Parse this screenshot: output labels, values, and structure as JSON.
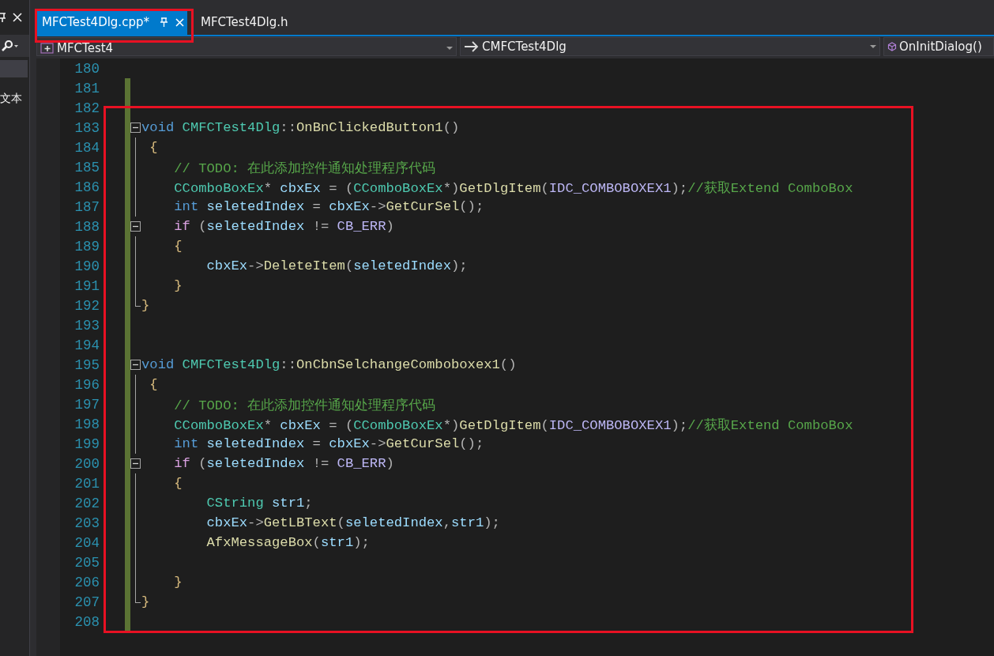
{
  "side_panel": {
    "label": "文本"
  },
  "tabs": [
    {
      "label": "MFCTest4Dlg.cpp*",
      "selected": true
    },
    {
      "label": "MFCTest4Dlg.h",
      "selected": false
    }
  ],
  "nav_bar": {
    "project": "MFCTest4",
    "class": "CMFCTest4Dlg",
    "member": "OnInitDialog()"
  },
  "lines": [
    {
      "number": "180",
      "changed": false,
      "kind": "plain"
    },
    {
      "number": "181",
      "changed": true,
      "kind": "plain"
    },
    {
      "number": "182",
      "changed": true,
      "kind": "plain"
    },
    {
      "number": "183",
      "changed": true,
      "kind": "foldstart",
      "tokens": [
        {
          "kind": "kw",
          "text": "void "
        },
        {
          "kind": "type",
          "text": "CMFCTest4Dlg"
        },
        {
          "kind": "punc",
          "text": "::"
        },
        {
          "kind": "fn",
          "text": "OnBnClickedButton1"
        },
        {
          "kind": "punc",
          "text": "()"
        }
      ]
    },
    {
      "number": "184",
      "changed": true,
      "kind": "foldbody",
      "tokens": [
        {
          "kind": "brace",
          "text": " {"
        }
      ]
    },
    {
      "number": "185",
      "changed": true,
      "kind": "foldbody",
      "tokens": [
        {
          "kind": "comment",
          "text": "    // TODO: 在此添加控件通知处理程序代码"
        }
      ]
    },
    {
      "number": "186",
      "changed": true,
      "kind": "foldbody",
      "tokens": [
        {
          "kind": "type",
          "text": "    CComboBoxEx"
        },
        {
          "kind": "plain",
          "text": "* "
        },
        {
          "kind": "var",
          "text": "cbxEx"
        },
        {
          "kind": "plain",
          "text": " = ("
        },
        {
          "kind": "type",
          "text": "CComboBoxEx"
        },
        {
          "kind": "plain",
          "text": "*)"
        },
        {
          "kind": "fn",
          "text": "GetDlgItem"
        },
        {
          "kind": "punc",
          "text": "("
        },
        {
          "kind": "macro",
          "text": "IDC_COMBOBOXEX1"
        },
        {
          "kind": "punc",
          "text": ");"
        },
        {
          "kind": "comment",
          "text": "//获取Extend ComboBox"
        }
      ]
    },
    {
      "number": "187",
      "changed": true,
      "kind": "foldbody",
      "tokens": [
        {
          "kind": "kw",
          "text": "    int "
        },
        {
          "kind": "var",
          "text": "seletedIndex"
        },
        {
          "kind": "plain",
          "text": " = "
        },
        {
          "kind": "var",
          "text": "cbxEx"
        },
        {
          "kind": "plain",
          "text": "->"
        },
        {
          "kind": "fn",
          "text": "GetCurSel"
        },
        {
          "kind": "punc",
          "text": "();"
        }
      ]
    },
    {
      "number": "188",
      "changed": true,
      "kind": "foldstart",
      "tokens": [
        {
          "kind": "ctrl",
          "text": "    if "
        },
        {
          "kind": "punc",
          "text": "("
        },
        {
          "kind": "var",
          "text": "seletedIndex"
        },
        {
          "kind": "plain",
          "text": " != "
        },
        {
          "kind": "macro",
          "text": "CB_ERR"
        },
        {
          "kind": "punc",
          "text": ")"
        }
      ]
    },
    {
      "number": "189",
      "changed": true,
      "kind": "foldbody",
      "tokens": [
        {
          "kind": "brace",
          "text": "    {"
        }
      ]
    },
    {
      "number": "190",
      "changed": true,
      "kind": "foldbody",
      "tokens": [
        {
          "kind": "var",
          "text": "        cbxEx"
        },
        {
          "kind": "plain",
          "text": "->"
        },
        {
          "kind": "fn",
          "text": "DeleteItem"
        },
        {
          "kind": "punc",
          "text": "("
        },
        {
          "kind": "var",
          "text": "seletedIndex"
        },
        {
          "kind": "punc",
          "text": ");"
        }
      ]
    },
    {
      "number": "191",
      "changed": true,
      "kind": "foldbody",
      "tokens": [
        {
          "kind": "brace",
          "text": "    }"
        }
      ]
    },
    {
      "number": "192",
      "changed": true,
      "kind": "foldend",
      "tokens": [
        {
          "kind": "brace",
          "text": "}"
        }
      ]
    },
    {
      "number": "193",
      "changed": true,
      "kind": "plain"
    },
    {
      "number": "194",
      "changed": true,
      "kind": "plain"
    },
    {
      "number": "195",
      "changed": true,
      "kind": "foldstart",
      "tokens": [
        {
          "kind": "kw",
          "text": "void "
        },
        {
          "kind": "type",
          "text": "CMFCTest4Dlg"
        },
        {
          "kind": "punc",
          "text": "::"
        },
        {
          "kind": "fn",
          "text": "OnCbnSelchangeComboboxex1"
        },
        {
          "kind": "punc",
          "text": "()"
        }
      ]
    },
    {
      "number": "196",
      "changed": true,
      "kind": "foldbody",
      "tokens": [
        {
          "kind": "brace",
          "text": " {"
        }
      ]
    },
    {
      "number": "197",
      "changed": true,
      "kind": "foldbody",
      "tokens": [
        {
          "kind": "comment",
          "text": "    // TODO: 在此添加控件通知处理程序代码"
        }
      ]
    },
    {
      "number": "198",
      "changed": true,
      "kind": "foldbody",
      "tokens": [
        {
          "kind": "type",
          "text": "    CComboBoxEx"
        },
        {
          "kind": "plain",
          "text": "* "
        },
        {
          "kind": "var",
          "text": "cbxEx"
        },
        {
          "kind": "plain",
          "text": " = ("
        },
        {
          "kind": "type",
          "text": "CComboBoxEx"
        },
        {
          "kind": "plain",
          "text": "*)"
        },
        {
          "kind": "fn",
          "text": "GetDlgItem"
        },
        {
          "kind": "punc",
          "text": "("
        },
        {
          "kind": "macro",
          "text": "IDC_COMBOBOXEX1"
        },
        {
          "kind": "punc",
          "text": ");"
        },
        {
          "kind": "comment",
          "text": "//获取Extend ComboBox"
        }
      ]
    },
    {
      "number": "199",
      "changed": true,
      "kind": "foldbody",
      "tokens": [
        {
          "kind": "kw",
          "text": "    int "
        },
        {
          "kind": "var",
          "text": "seletedIndex"
        },
        {
          "kind": "plain",
          "text": " = "
        },
        {
          "kind": "var",
          "text": "cbxEx"
        },
        {
          "kind": "plain",
          "text": "->"
        },
        {
          "kind": "fn",
          "text": "GetCurSel"
        },
        {
          "kind": "punc",
          "text": "();"
        }
      ]
    },
    {
      "number": "200",
      "changed": true,
      "kind": "foldstart",
      "tokens": [
        {
          "kind": "ctrl",
          "text": "    if "
        },
        {
          "kind": "punc",
          "text": "("
        },
        {
          "kind": "var",
          "text": "seletedIndex"
        },
        {
          "kind": "plain",
          "text": " != "
        },
        {
          "kind": "macro",
          "text": "CB_ERR"
        },
        {
          "kind": "punc",
          "text": ")"
        }
      ]
    },
    {
      "number": "201",
      "changed": true,
      "kind": "foldbody",
      "tokens": [
        {
          "kind": "brace",
          "text": "    {"
        }
      ]
    },
    {
      "number": "202",
      "changed": true,
      "kind": "foldbody",
      "tokens": [
        {
          "kind": "type",
          "text": "        CString "
        },
        {
          "kind": "var",
          "text": "str1"
        },
        {
          "kind": "punc",
          "text": ";"
        }
      ]
    },
    {
      "number": "203",
      "changed": true,
      "kind": "foldbody",
      "tokens": [
        {
          "kind": "var",
          "text": "        cbxEx"
        },
        {
          "kind": "plain",
          "text": "->"
        },
        {
          "kind": "fn",
          "text": "GetLBText"
        },
        {
          "kind": "punc",
          "text": "("
        },
        {
          "kind": "var",
          "text": "seletedIndex"
        },
        {
          "kind": "punc",
          "text": ","
        },
        {
          "kind": "var",
          "text": "str1"
        },
        {
          "kind": "punc",
          "text": ");"
        }
      ]
    },
    {
      "number": "204",
      "changed": true,
      "kind": "foldbody",
      "tokens": [
        {
          "kind": "fn",
          "text": "        AfxMessageBox"
        },
        {
          "kind": "punc",
          "text": "("
        },
        {
          "kind": "var",
          "text": "str1"
        },
        {
          "kind": "punc",
          "text": ");"
        }
      ]
    },
    {
      "number": "205",
      "changed": true,
      "kind": "foldbody"
    },
    {
      "number": "206",
      "changed": true,
      "kind": "foldbody",
      "tokens": [
        {
          "kind": "brace",
          "text": "    }"
        }
      ]
    },
    {
      "number": "207",
      "changed": true,
      "kind": "foldend",
      "tokens": [
        {
          "kind": "brace",
          "text": "}"
        }
      ]
    },
    {
      "number": "208",
      "changed": true,
      "kind": "plain"
    }
  ]
}
